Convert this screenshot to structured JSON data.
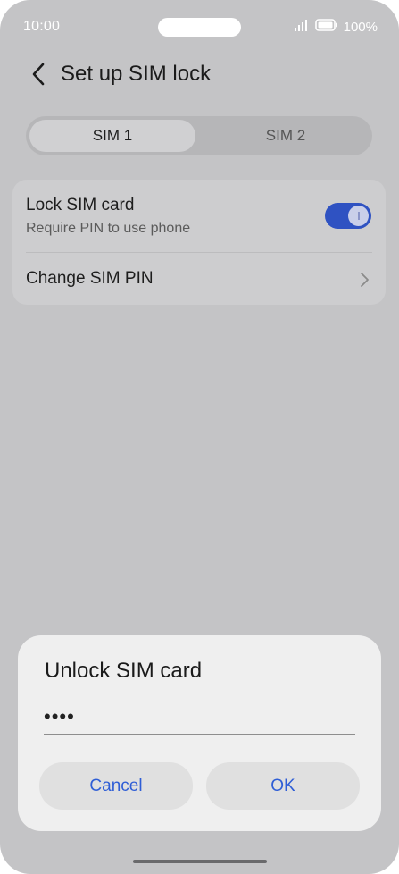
{
  "status_bar": {
    "time": "10:00",
    "battery_percent": "100%"
  },
  "header": {
    "title": "Set up SIM lock"
  },
  "tabs": [
    {
      "label": "SIM 1",
      "active": true
    },
    {
      "label": "SIM 2",
      "active": false
    }
  ],
  "settings": {
    "lock_sim": {
      "title": "Lock SIM card",
      "subtitle": "Require PIN to use phone",
      "enabled": true
    },
    "change_pin": {
      "title": "Change SIM PIN"
    }
  },
  "dialog": {
    "title": "Unlock SIM card",
    "pin_value": "••••",
    "cancel_label": "Cancel",
    "ok_label": "OK"
  },
  "colors": {
    "accent": "#2f52c2",
    "button_text": "#2f5ed6"
  }
}
